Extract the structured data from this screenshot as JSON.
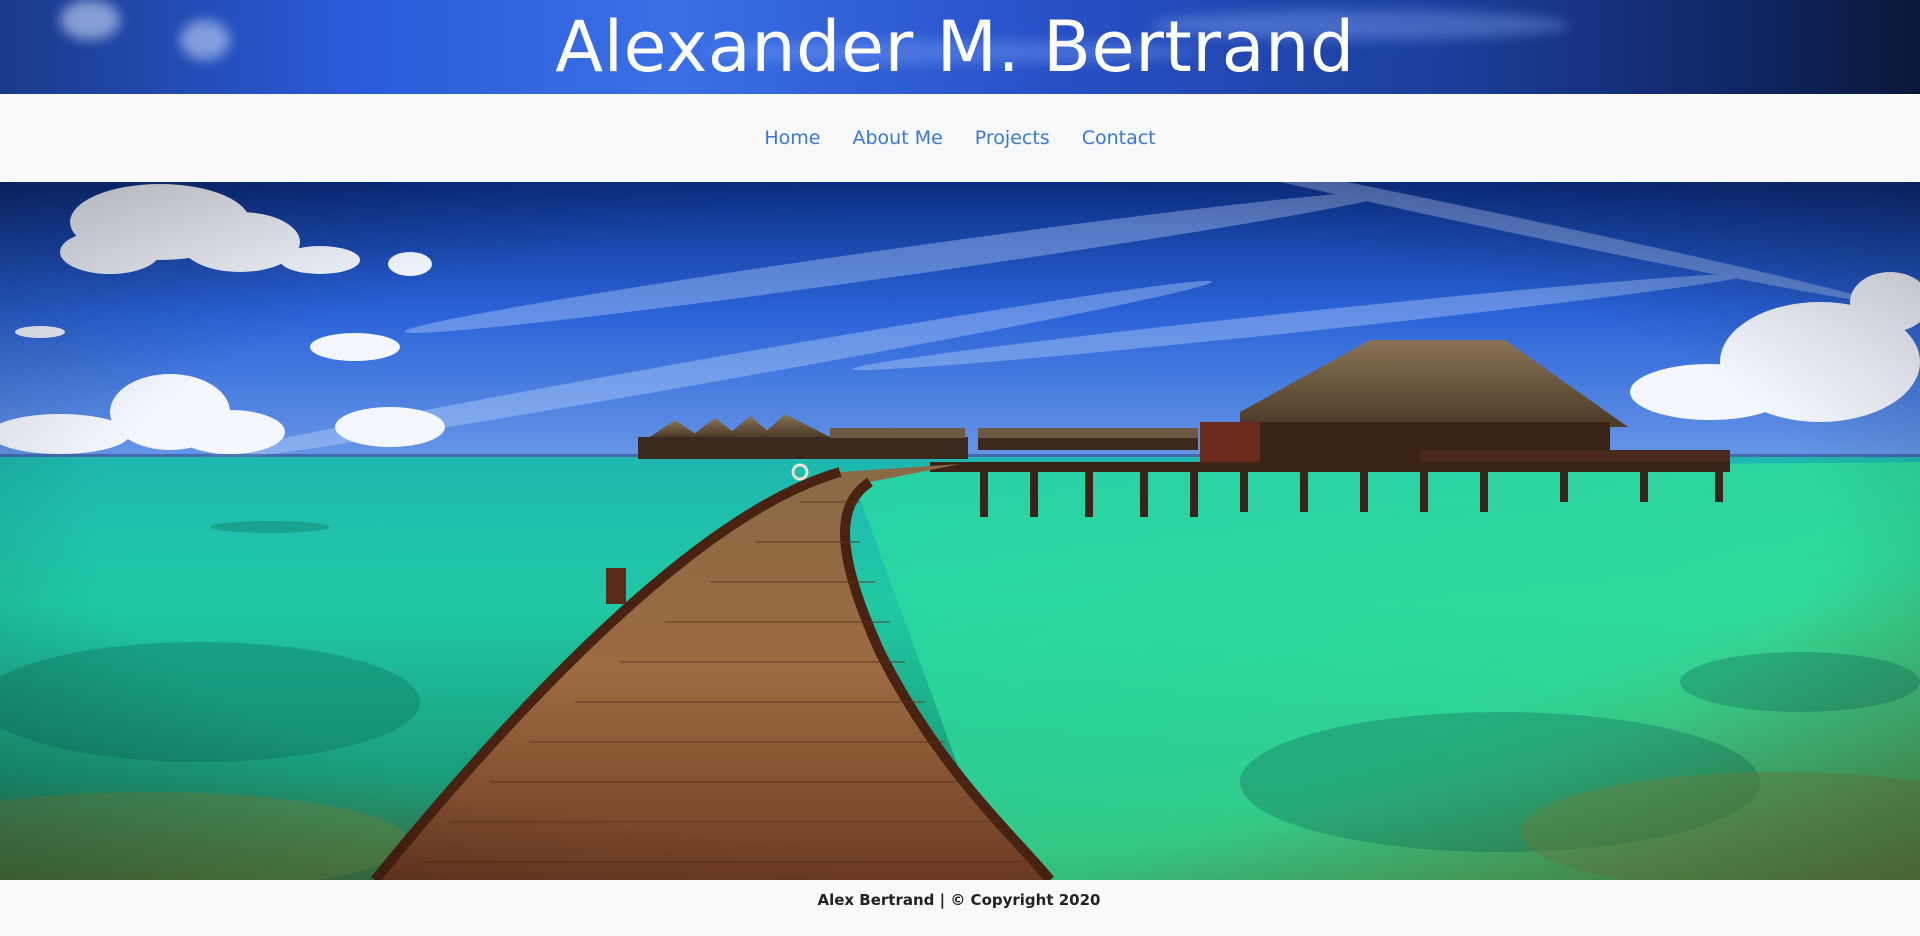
{
  "header": {
    "title": "Alexander M. Bertrand"
  },
  "nav": {
    "items": [
      {
        "label": "Home"
      },
      {
        "label": "About Me"
      },
      {
        "label": "Projects"
      },
      {
        "label": "Contact"
      }
    ],
    "link_color": "#3a77d8"
  },
  "hero": {
    "image": "tropical-overwater-bungalows-boardwalk"
  },
  "footer": {
    "text": "Alex Bertrand | © Copyright 2020"
  },
  "colors": {
    "background": "#f8f9fa",
    "header_blue": "#2750c6"
  }
}
